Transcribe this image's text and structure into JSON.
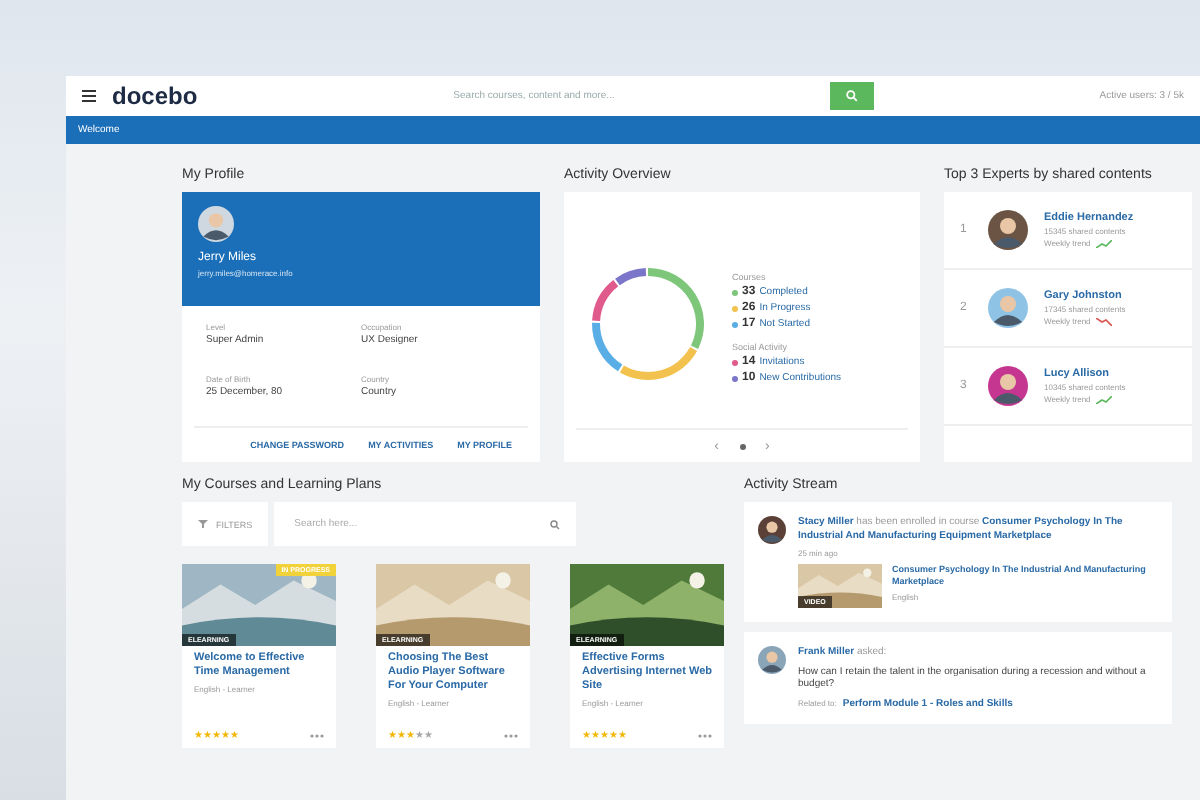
{
  "header": {
    "logo": "docebo",
    "search": {
      "placeholder": "Search courses, content and more..."
    },
    "user_info": "Active users: 3 / 5k"
  },
  "nav": {
    "title": "Welcome"
  },
  "profile": {
    "title": "My Profile",
    "name": "Jerry Miles",
    "email": "jerry.miles@homerace.info",
    "fields": [
      {
        "label": "Level",
        "value": "Super Admin"
      },
      {
        "label": "Occupation",
        "value": "UX Designer"
      },
      {
        "label": "Date of Birth",
        "value": "25 December, 80"
      },
      {
        "label": "Country",
        "value": "Country"
      }
    ],
    "links": [
      "CHANGE PASSWORD",
      "MY ACTIVITIES",
      "MY PROFILE"
    ]
  },
  "activity": {
    "title": "Activity Overview",
    "chart_data": {
      "type": "donut",
      "categories": [
        "Completed",
        "In Progress",
        "Not Started",
        "Invitations",
        "New Contributions"
      ],
      "values": [
        33,
        26,
        17,
        14,
        10
      ]
    },
    "groups": [
      {
        "heading": "Courses",
        "items": [
          {
            "count": "33",
            "color": "#7dc67a"
          },
          {
            "count": "26",
            "color": "#f2c14e"
          },
          {
            "count": "17",
            "color": "#5aaee6"
          }
        ]
      },
      {
        "heading": "Social Activity",
        "items": [
          {
            "count": "14",
            "color": "#e05a8c"
          },
          {
            "count": "10",
            "color": "#7b76c9"
          }
        ]
      }
    ],
    "pager": {
      "prev": "‹",
      "next": "›"
    }
  },
  "experts": {
    "title": "Top 3 Experts by shared contents",
    "items": [
      {
        "rank": "1",
        "name": "Eddie Hernandez",
        "shared": "15345 shared contents",
        "trend_label": "Weekly trend",
        "trending_up": true
      },
      {
        "rank": "2",
        "name": "Gary Johnston",
        "shared": "17345 shared contents",
        "trend_label": "Weekly trend",
        "trending_up": false
      },
      {
        "rank": "3",
        "name": "Lucy Allison",
        "shared": "10345 shared contents",
        "trend_label": "Weekly trend",
        "trending_up": true
      }
    ]
  },
  "courses": {
    "title": "My Courses and Learning Plans",
    "filter_label": "FILTERS",
    "search": {
      "placeholder": "Search here..."
    },
    "items": [
      {
        "type_badge": "ELEARNING",
        "status_badge": "IN PROGRESS",
        "title": "Welcome to Effective Time Management",
        "meta": "English - Learner",
        "stars": 5
      },
      {
        "type_badge": "ELEARNING",
        "title": "Choosing The Best Audio Player Software For Your Computer",
        "meta": "English - Learner",
        "stars": 3
      },
      {
        "type_badge": "ELEARNING",
        "title": "Effective Forms Advertising Internet Web Site",
        "meta": "English - Learner",
        "stars": 5
      }
    ]
  },
  "stream": {
    "title": "Activity Stream",
    "posts": [
      {
        "kind": "enrollment",
        "text": "**Stacy Miller** has been enrolled in course **Consumer Psychology In The Industrial And Manufacturing Equipment Marketplace**",
        "time": "25 min ago",
        "attachment": {
          "badge": "VIDEO",
          "title": "Consumer Psychology In The Industrial And Manufacturing Marketplace",
          "meta": "English"
        }
      },
      {
        "kind": "question",
        "text": "**Frank Miller** asked:",
        "body": "How can I retain the talent in the organisation during a recession and without a budget?",
        "related_label": "Related to:",
        "related": "Perform Module 1 - Roles and Skills"
      }
    ]
  }
}
